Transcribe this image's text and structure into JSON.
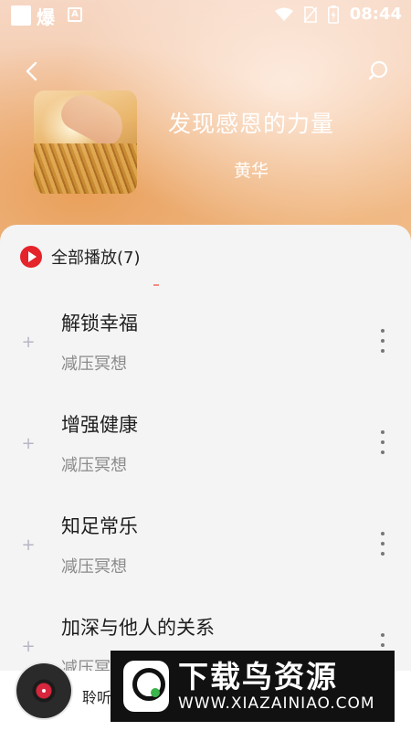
{
  "status_bar": {
    "notification_glyph": "爆",
    "badge_letter": "A",
    "time": "08:44",
    "icons": [
      "wifi-icon",
      "no-sim-icon",
      "battery-charging-icon"
    ]
  },
  "header": {
    "back_icon": "chevron-left-icon",
    "search_icon": "search-icon"
  },
  "album": {
    "title": "发现感恩的力量",
    "artist": "黄华"
  },
  "list": {
    "play_all_label": "全部播放(7)",
    "tracks": [
      {
        "name": "解锁幸福",
        "category": "减压冥想"
      },
      {
        "name": "增强健康",
        "category": "减压冥想"
      },
      {
        "name": "知足常乐",
        "category": "减压冥想"
      },
      {
        "name": "加深与他人的关系",
        "category": "减压冥想"
      }
    ]
  },
  "player": {
    "now_playing_text": "聆听"
  },
  "watermark": {
    "brand": "下载鸟资源",
    "url": "WWW.XIAZAINIAO.COM"
  },
  "colors": {
    "accent_red": "#e5232a",
    "panel_bg": "#f4f4f4"
  }
}
